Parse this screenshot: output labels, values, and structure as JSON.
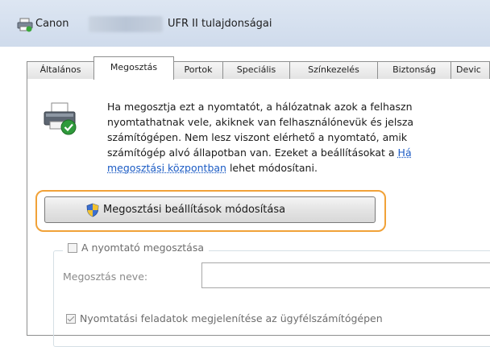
{
  "window": {
    "title_left": "Canon",
    "title_right": "UFR II tulajdonságai"
  },
  "tabs": [
    {
      "label": "Általános"
    },
    {
      "label": "Megosztás",
      "active": true
    },
    {
      "label": "Portok"
    },
    {
      "label": "Speciális"
    },
    {
      "label": "Színkezelés"
    },
    {
      "label": "Biztonság"
    },
    {
      "label": "Devic"
    }
  ],
  "sharing": {
    "description_lines": [
      "Ha megosztja ezt a nyomtatót, a hálózatnak azok a felhaszn",
      "nyomtathatnak vele, akiknek van felhasználónevük és jelsza",
      "számítógépen. Nem lesz viszont elérhető a nyomtató, amik",
      "számítógép alvó állapotban van. Ezeket a beállításokat a"
    ],
    "link_start": "Há",
    "link_rest": "megosztási központban",
    "after_link": " lehet módosítani.",
    "change_button_label": "Megosztási beállítások módosítása",
    "share_checkbox_label": "A nyomtató megosztása",
    "share_name_label": "Megosztás neve:",
    "share_name_value": "",
    "render_checkbox_label": "Nyomtatási feladatok megjelenítése az ügyfélszámítógépen"
  },
  "colors": {
    "highlight": "#f1a238",
    "link": "#1b5bc4",
    "titlebar": "#d6e0ee"
  }
}
